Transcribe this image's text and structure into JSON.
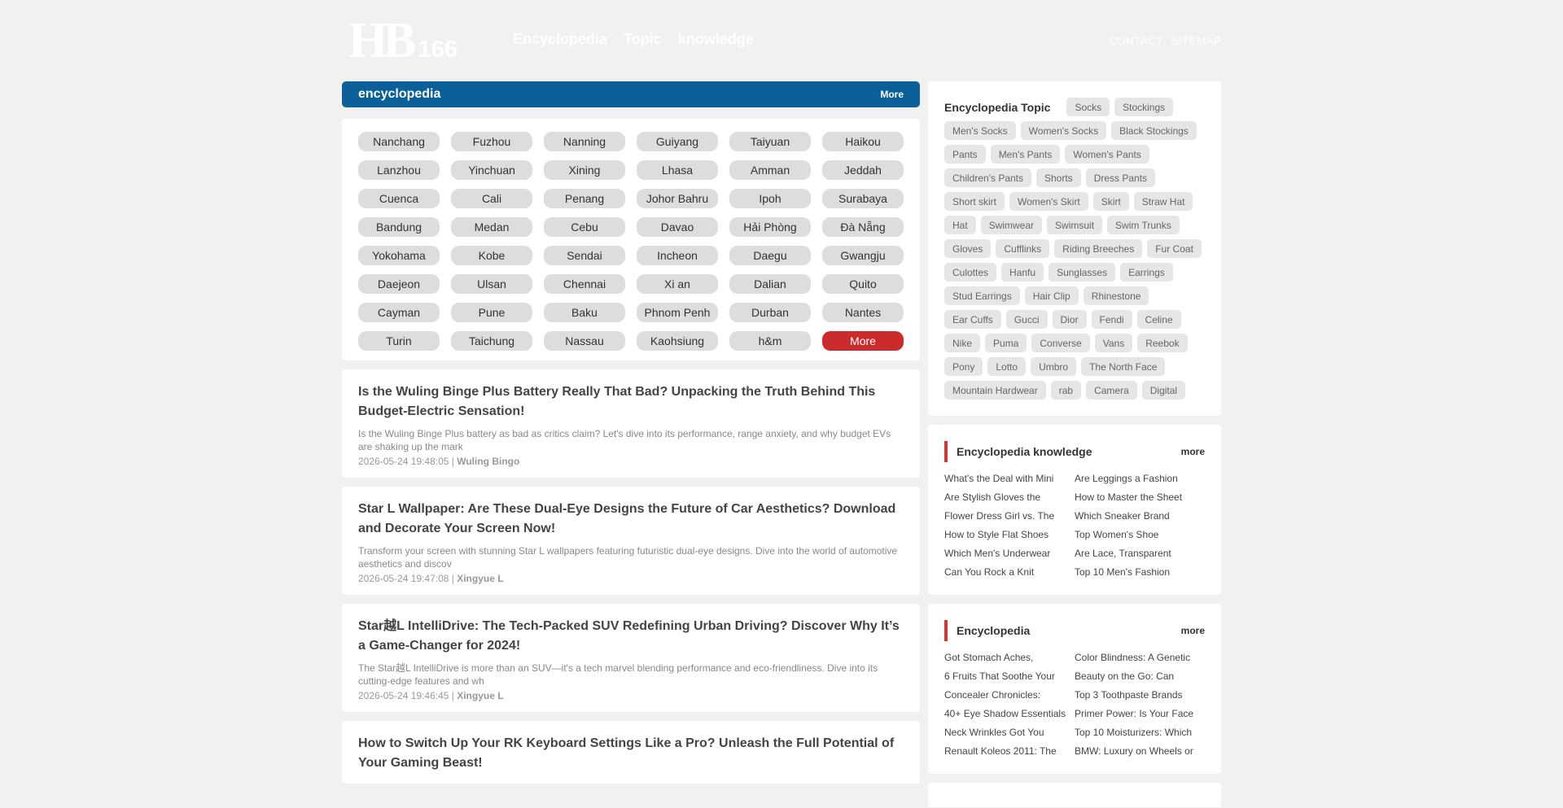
{
  "header": {
    "logo_main": "HB",
    "logo_num": "166",
    "nav": [
      "Encyclopedia",
      "Topic",
      "knowledge"
    ],
    "links": [
      "CONTACT",
      "SITEMAP"
    ]
  },
  "encyclopedia_bar": {
    "title": "encyclopedia",
    "more": "More"
  },
  "cities": [
    "Nanchang",
    "Fuzhou",
    "Nanning",
    "Guiyang",
    "Taiyuan",
    "Haikou",
    "Lanzhou",
    "Yinchuan",
    "Xining",
    "Lhasa",
    "Amman",
    "Jeddah",
    "Cuenca",
    "Cali",
    "Penang",
    "Johor Bahru",
    "Ipoh",
    "Surabaya",
    "Bandung",
    "Medan",
    "Cebu",
    "Davao",
    "Hải Phòng",
    "Đà Nẵng",
    "Yokohama",
    "Kobe",
    "Sendai",
    "Incheon",
    "Daegu",
    "Gwangju",
    "Daejeon",
    "Ulsan",
    "Chennai",
    "Xi an",
    "Dalian",
    "Quito",
    "Cayman",
    "Pune",
    "Baku",
    "Phnom Penh",
    "Durban",
    "Nantes",
    "Turin",
    "Taichung",
    "Nassau",
    "Kaohsiung",
    "h&m",
    "More"
  ],
  "articles": [
    {
      "title": " Is the Wuling Binge Plus Battery Really That Bad?  Unpacking the Truth Behind This Budget-Electric Sensation! ",
      "summary": "Is the Wuling Binge Plus battery as bad as critics claim? Let's dive into its performance, range anxiety, and why budget EVs are shaking up the mark",
      "date": "2026-05-24 19:48:05 | ",
      "tag": "Wuling Bingo"
    },
    {
      "title": " Star L Wallpaper: Are These Dual-Eye Designs the Future of Car Aesthetics?  Download and Decorate Your Screen Now! ",
      "summary": "Transform your screen with stunning Star L wallpapers featuring futuristic dual-eye designs. Dive into the world of automotive aesthetics and discov",
      "date": "2026-05-24 19:47:08 | ",
      "tag": "Xingyue L"
    },
    {
      "title": " Star越L IntelliDrive: The Tech-Packed SUV Redefining Urban Driving?  Discover Why It’s a Game-Changer for 2024!",
      "summary": "The Star越L IntelliDrive is more than an SUV—it's a tech marvel blending performance and eco-friendliness. Dive into its cutting-edge features and wh",
      "date": "2026-05-24 19:46:45 | ",
      "tag": "Xingyue L"
    },
    {
      "title": " How to Switch Up Your RK Keyboard Settings Like a Pro?  Unleash the Full Potential of Your Gaming Beast!",
      "summary": "",
      "date": "",
      "tag": ""
    }
  ],
  "topic_panel": {
    "title": "Encyclopedia Topic",
    "tags": [
      "Socks",
      "Stockings",
      "Men's Socks",
      "Women's Socks",
      "Black Stockings",
      "Pants",
      "Men's Pants",
      "Women's Pants",
      "Children's Pants",
      "Shorts",
      "Dress Pants",
      "Short skirt",
      "Women's Skirt",
      "Skirt",
      "Straw Hat",
      "Hat",
      "Swimwear",
      "Swimsuit",
      "Swim Trunks",
      "Gloves",
      "Cufflinks",
      "Riding Breeches",
      "Fur Coat",
      "Culottes",
      "Hanfu",
      "Sunglasses",
      "Earrings",
      "Stud Earrings",
      "Hair Clip",
      "Rhinestone",
      "Ear Cuffs",
      "Gucci",
      "Dior",
      "Fendi",
      "Celine",
      "Nike",
      "Puma",
      "Converse",
      "Vans",
      "Reebok",
      "Pony",
      "Lotto",
      "Umbro",
      "The North Face",
      "Mountain Hardwear",
      "rab",
      "Camera",
      "Digital"
    ]
  },
  "knowledge_panel": {
    "title": "Encyclopedia knowledge",
    "more": "more",
    "items": [
      " What's the Deal with Mini",
      " Are Leggings a Fashion",
      " Are Stylish Gloves the",
      " How to Master the Sheet",
      " Flower Dress Girl vs. The",
      " Which Sneaker Brand",
      " How to Style Flat Shoes",
      " Top Women's Shoe",
      " Which Men's Underwear",
      " Are Lace, Transparent",
      " Can You Rock a Knit",
      " Top 10 Men's Fashion"
    ]
  },
  "encyclopedia_panel": {
    "title": "Encyclopedia",
    "more": "more",
    "items": [
      "Got Stomach Aches,",
      "Color Blindness: A Genetic",
      "6 Fruits That Soothe Your",
      "Beauty on the Go: Can",
      "Concealer Chronicles:",
      "Top 3 Toothpaste Brands",
      "40+ Eye Shadow Essentials:",
      "Primer Power: Is Your Face",
      "Neck Wrinkles Got You",
      "Top 10 Moisturizers: Which",
      "Renault Koleos 2011: The",
      "BMW: Luxury on Wheels or"
    ]
  }
}
